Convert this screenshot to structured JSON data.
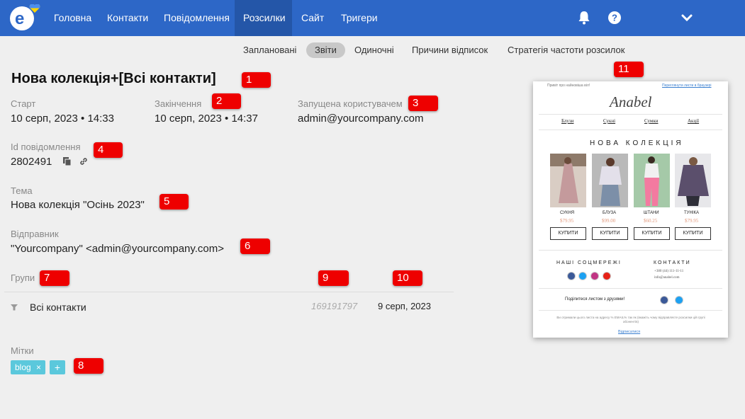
{
  "nav": {
    "items": [
      "Головна",
      "Контакти",
      "Повідомлення",
      "Розсилки",
      "Сайт",
      "Тригери"
    ]
  },
  "subnav": [
    "Заплановані",
    "Звіти",
    "Одиночні",
    "Причини відписок",
    "Стратегія частоти розсилок"
  ],
  "page": {
    "title": "Нова колекція+[Всі контакти]",
    "start_label": "Старт",
    "start_value": "10 серп, 2023 • 14:33",
    "end_label": "Закінчення",
    "end_value": "10 серп, 2023 • 14:37",
    "launched_label": "Запущена користувачем",
    "launched_value": "admin@yourcompany.com",
    "id_label": "Id повідомлення",
    "id_value": "2802491",
    "subject_label": "Тема",
    "subject_value": "Нова колекція \"Осінь 2023\"",
    "sender_label": "Відправник",
    "sender_value": "\"Yourcompany\" <admin@yourcompany.com>",
    "groups_label": "Групи",
    "group_name": "Всі контакти",
    "group_count": "169191797",
    "group_date": "9 серп, 2023",
    "tags_label": "Мітки",
    "tag": "blog",
    "tag_remove": "×",
    "tag_add": "+"
  },
  "badges": [
    "1",
    "2",
    "3",
    "4",
    "5",
    "6",
    "7",
    "8",
    "9",
    "10",
    "11"
  ],
  "preview": {
    "top_left": "Привіт про найновіша віл!",
    "top_right": "Переглянути листи в браузері",
    "brand": "Anabel",
    "menu": [
      "Блузи",
      "Сукні",
      "Сумки",
      "Акції"
    ],
    "heading": "НОВА КОЛЕКЦІЯ",
    "products": [
      {
        "name": "СУКНЯ",
        "price": "$79.95"
      },
      {
        "name": "БЛУЗА",
        "price": "$99.00"
      },
      {
        "name": "ШТАНИ",
        "price": "$60.25"
      },
      {
        "name": "ТУНІКА",
        "price": "$79.95"
      }
    ],
    "buy": "КУПИТИ",
    "social_title": "НАШІ СОЦМЕРЕЖІ",
    "contacts_title": "КОНТАКТИ",
    "phone": "+380 (44) 111-11-11",
    "email": "info@anabel.com",
    "share": "Поділитеся листом з друзями!",
    "footer": "Ви отримали цього листа на адресу % EMAIL% так як (вкажіть чому відправляєте розсилки цій групі абонентів)",
    "unsubscribe": "Відписатися"
  },
  "colors": {
    "nav_bg": "#2d67c7",
    "nav_active": "#2456a8",
    "badge": "#e00000",
    "tag": "#5bc8dc",
    "price": "#e39a7d"
  }
}
